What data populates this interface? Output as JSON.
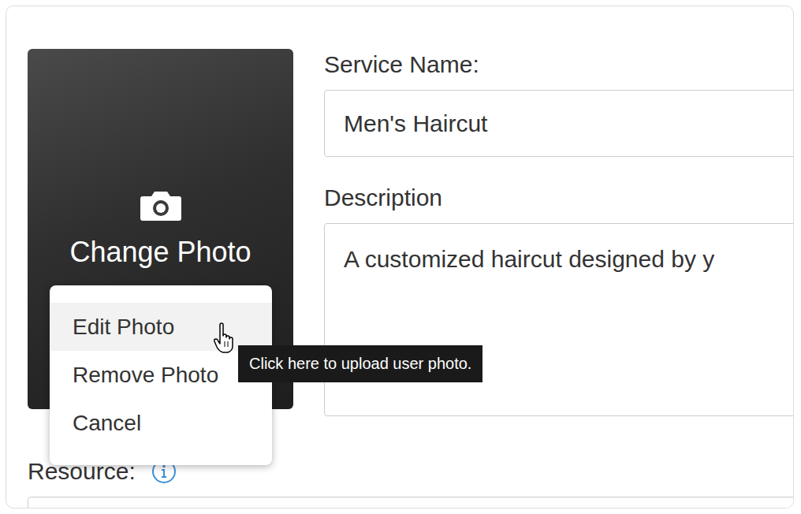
{
  "photo": {
    "overlay_label": "Change Photo"
  },
  "photo_menu": {
    "items": [
      {
        "label": "Edit Photo",
        "selected": true
      },
      {
        "label": "Remove Photo",
        "selected": false
      },
      {
        "label": "Cancel",
        "selected": false
      }
    ]
  },
  "tooltip": {
    "text": "Click here to upload user photo."
  },
  "fields": [
    {
      "label": "Service Name:",
      "value": "Men's Haircut",
      "kind": "input"
    },
    {
      "label": "Description",
      "value": "A customized haircut designed by y",
      "kind": "textarea"
    }
  ],
  "resource": {
    "label": "Resource:"
  }
}
